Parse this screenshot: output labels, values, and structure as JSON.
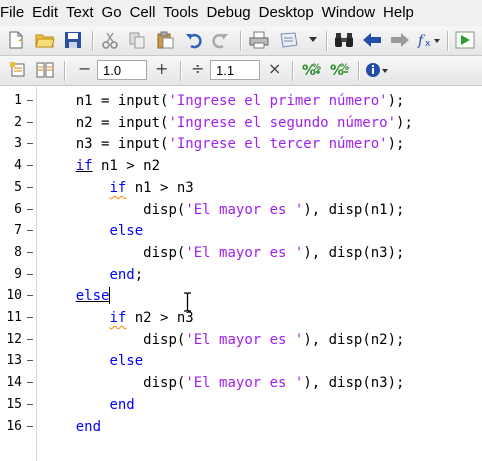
{
  "menu": [
    "File",
    "Edit",
    "Text",
    "Go",
    "Cell",
    "Tools",
    "Debug",
    "Desktop",
    "Window",
    "Help"
  ],
  "toolbar2": {
    "decrement_symbol": "−",
    "step_value": "1.0",
    "increment_symbol": "+",
    "divide_symbol": "÷",
    "scale_value": "1.1",
    "multiply_symbol": "×"
  },
  "colors": {
    "keyword": "#0000ff",
    "string": "#a020f0",
    "text": "#000000",
    "warning_squiggle": "#ff8000"
  },
  "code_lines": [
    {
      "n": "1",
      "indent": 4,
      "parts": [
        {
          "t": "txt",
          "v": "n1 = input("
        },
        {
          "t": "str",
          "v": "'Ingrese el primer número'"
        },
        {
          "t": "txt",
          "v": ");"
        }
      ]
    },
    {
      "n": "2",
      "indent": 4,
      "parts": [
        {
          "t": "txt",
          "v": "n2 = input("
        },
        {
          "t": "str",
          "v": "'Ingrese el segundo número'"
        },
        {
          "t": "txt",
          "v": ");"
        }
      ]
    },
    {
      "n": "3",
      "indent": 4,
      "parts": [
        {
          "t": "txt",
          "v": "n3 = input("
        },
        {
          "t": "str",
          "v": "'Ingrese el tercer número'"
        },
        {
          "t": "txt",
          "v": ");"
        }
      ]
    },
    {
      "n": "4",
      "indent": 4,
      "parts": [
        {
          "t": "kw",
          "v": "if",
          "u": true
        },
        {
          "t": "txt",
          "v": " n1 > n2"
        }
      ]
    },
    {
      "n": "5",
      "indent": 8,
      "parts": [
        {
          "t": "kw",
          "v": "if",
          "sq": true
        },
        {
          "t": "txt",
          "v": " n1 > n3"
        }
      ]
    },
    {
      "n": "6",
      "indent": 12,
      "parts": [
        {
          "t": "txt",
          "v": "disp("
        },
        {
          "t": "str",
          "v": "'El mayor es '"
        },
        {
          "t": "txt",
          "v": "), disp(n1);"
        }
      ]
    },
    {
      "n": "7",
      "indent": 8,
      "parts": [
        {
          "t": "kw",
          "v": "else"
        }
      ]
    },
    {
      "n": "8",
      "indent": 12,
      "parts": [
        {
          "t": "txt",
          "v": "disp("
        },
        {
          "t": "str",
          "v": "'El mayor es '"
        },
        {
          "t": "txt",
          "v": "), disp(n3);"
        }
      ]
    },
    {
      "n": "9",
      "indent": 8,
      "parts": [
        {
          "t": "kw",
          "v": "end"
        },
        {
          "t": "txt",
          "v": ";"
        }
      ]
    },
    {
      "n": "10",
      "indent": 4,
      "parts": [
        {
          "t": "kw",
          "v": "else",
          "u": true
        }
      ]
    },
    {
      "n": "11",
      "indent": 8,
      "parts": [
        {
          "t": "kw",
          "v": "if",
          "sq": true
        },
        {
          "t": "txt",
          "v": " n2 > n3"
        }
      ]
    },
    {
      "n": "12",
      "indent": 12,
      "parts": [
        {
          "t": "txt",
          "v": "disp("
        },
        {
          "t": "str",
          "v": "'El mayor es '"
        },
        {
          "t": "txt",
          "v": "), disp(n2);"
        }
      ]
    },
    {
      "n": "13",
      "indent": 8,
      "parts": [
        {
          "t": "kw",
          "v": "else"
        }
      ]
    },
    {
      "n": "14",
      "indent": 12,
      "parts": [
        {
          "t": "txt",
          "v": "disp("
        },
        {
          "t": "str",
          "v": "'El mayor es '"
        },
        {
          "t": "txt",
          "v": "), disp(n3);"
        }
      ]
    },
    {
      "n": "15",
      "indent": 8,
      "parts": [
        {
          "t": "kw",
          "v": "end"
        }
      ]
    },
    {
      "n": "16",
      "indent": 4,
      "parts": [
        {
          "t": "kw",
          "v": "end"
        }
      ]
    }
  ],
  "icons": {
    "toolbar1": [
      "new-file-icon",
      "open-folder-icon",
      "save-icon",
      "cut-icon",
      "copy-icon",
      "paste-icon",
      "undo-icon",
      "redo-icon",
      "print-icon",
      "print-preview-icon",
      "dropdown-arrow-icon",
      "find-icon",
      "back-arrow-icon",
      "forward-arrow-icon",
      "function-browser-icon",
      "run-icon"
    ],
    "toolbar2": [
      "insert-cell-icon",
      "evaluate-cell-icon",
      "cell-percent-icon",
      "cell-percent-icon",
      "info-icon"
    ]
  }
}
